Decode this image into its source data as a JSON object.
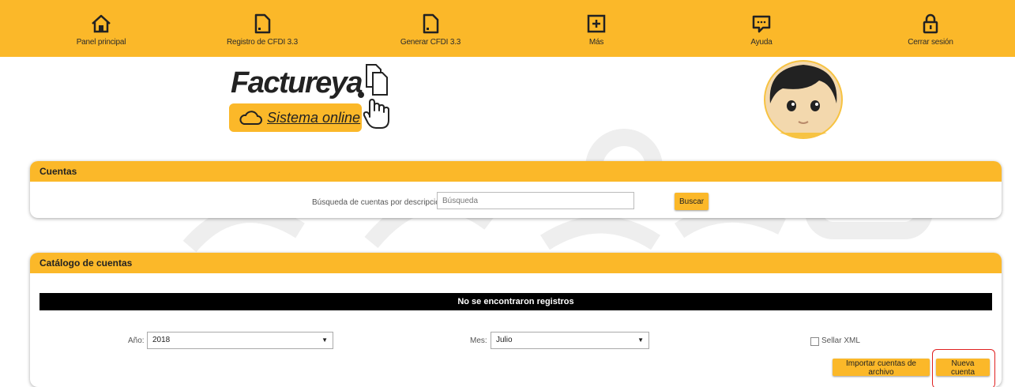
{
  "nav": {
    "items": [
      {
        "label": "Panel principal",
        "icon": "home-icon"
      },
      {
        "label": "Registro de CFDI 3.3",
        "icon": "document-icon"
      },
      {
        "label": "Generar CFDI 3.3",
        "icon": "document-icon"
      },
      {
        "label": "Más",
        "icon": "plus-box-icon"
      },
      {
        "label": "Ayuda",
        "icon": "chat-bubble-icon"
      },
      {
        "label": "Cerrar sesión",
        "icon": "lock-icon"
      }
    ]
  },
  "logo": {
    "brand": "Factureya",
    "tagline": "Sistema online"
  },
  "cuentas": {
    "title": "Cuentas",
    "search_label": "Búsqueda de cuentas por descripción:",
    "search_placeholder": "Búsqueda",
    "search_button": "Buscar"
  },
  "catalogo": {
    "title": "Catálogo de cuentas",
    "empty_message": "No se encontraron registros",
    "year_label": "Año:",
    "year_value": "2018",
    "month_label": "Mes:",
    "month_value": "Julio",
    "seal_label": "Sellar XML",
    "seal_checked": false,
    "import_button": "Importar cuentas de archivo",
    "new_button": "Nueva cuenta"
  },
  "colors": {
    "accent": "#fbb829",
    "highlight": "#e02020"
  }
}
